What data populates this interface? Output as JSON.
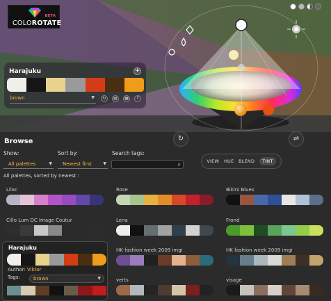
{
  "app": {
    "logo_word_a": "COLO",
    "logo_word_b": "ROTATE",
    "logo_badge": "BETA"
  },
  "top_icons": [
    "reset-icon",
    "small-circle-icon",
    "half-circle-icon",
    "full-circle-icon"
  ],
  "current_palette": {
    "name": "Harajuku",
    "add_label": "+",
    "swatches": [
      "#f1efe9",
      "#161616",
      "#e9d28e",
      "#9a9a9a",
      "#d43c15",
      "#4a2e12",
      "#ef9c1a"
    ],
    "tag": "brown",
    "action_icons": [
      "refresh-icon",
      "save-icon",
      "grid-icon",
      "facebook-icon"
    ]
  },
  "modes": [
    {
      "label": "VIEW",
      "active": false
    },
    {
      "label": "HUE",
      "active": false
    },
    {
      "label": "BLEND",
      "active": false
    },
    {
      "label": "TINT",
      "active": true
    }
  ],
  "browse": {
    "title": "Browse",
    "show_label": "Show:",
    "show_value": "All palettes",
    "sort_label": "Sort by:",
    "sort_value": "Newest first",
    "search_label": "Search tags:",
    "search_value": "",
    "sorted_caption": "All palettes, sorted by newest :"
  },
  "palettes": [
    {
      "name": "Lilac",
      "swatches": [
        "#b9b3c6",
        "#e5c3d6",
        "#d77fcb",
        "#b453c6",
        "#9b49c0",
        "#6248a8",
        "#38347a"
      ]
    },
    {
      "name": "Rose",
      "swatches": [
        "#c5d5b8",
        "#a8c38c",
        "#e5b240",
        "#e38c28",
        "#d8472a",
        "#c42028",
        "#8a1b2a"
      ]
    },
    {
      "name": "Bikini Blues",
      "swatches": [
        "#111111",
        "#98553f",
        "#4a67a9",
        "#2d5098",
        "#e6e6e2",
        "#afc2d6",
        "#5b6e8a"
      ]
    },
    {
      "name": "Cillo Lum DC Image Coutur",
      "swatches": [
        "#2e2e2e",
        "#3a3a3a",
        "#c8c8c8",
        "#8a8a8a",
        "#2a2a2a",
        "#2b2b2b",
        "#2c2c2c"
      ]
    },
    {
      "name": "Lena",
      "swatches": [
        "#efefeb",
        "#111111",
        "#676e70",
        "#a0a3a0",
        "#2f3f4c",
        "#d2d2d2",
        "#404850"
      ]
    },
    {
      "name": "Frond",
      "swatches": [
        "#4c9a2a",
        "#7ec23b",
        "#1f4d22",
        "#5aa35a",
        "#7cc68f",
        "#95cc4c",
        "#c9e05c"
      ]
    },
    {
      "name": "HK fashion week 2009 imgi",
      "swatches": [
        "#6e4f93",
        "#9b7dbd",
        "#202020",
        "#6b3b2a",
        "#e3b28e",
        "#8e5d3a",
        "#2b6a7a"
      ]
    },
    {
      "name": "HK fashion week 2009 imgi",
      "swatches": [
        "#22343d",
        "#667e8c",
        "#aab8bb",
        "#d9d9d6",
        "#a07d55",
        "#3b2f26",
        "#c2a36b"
      ]
    },
    {
      "name": "verts",
      "swatches": [
        "#9c6a49",
        "#b2b8bd",
        "#252525",
        "#4f3a30",
        "#d4c4aa",
        "#7c1f1f",
        "#222222"
      ]
    },
    {
      "name": "visage",
      "swatches": [
        "#1a1a1a",
        "#c7c3bd",
        "#8a6f60",
        "#d8d0c8",
        "#5f4636",
        "#a88a70",
        "#3a2a20"
      ]
    }
  ],
  "hover_palette": {
    "name": "Harajuku",
    "swatches": [
      "#f1efe9",
      "#161616",
      "#e9d28e",
      "#9a9a9a",
      "#d43c15",
      "#4a2e12",
      "#ef9c1a"
    ],
    "author_label": "Author:",
    "author": "Viktor",
    "tags_label": "Tags:",
    "tag": "brown",
    "swatches2": [
      "#6a8f8f",
      "#d5cbb7",
      "#5e3d26",
      "#111111",
      "#6a5a4a",
      "#8e1818",
      "#c11d1d"
    ]
  }
}
